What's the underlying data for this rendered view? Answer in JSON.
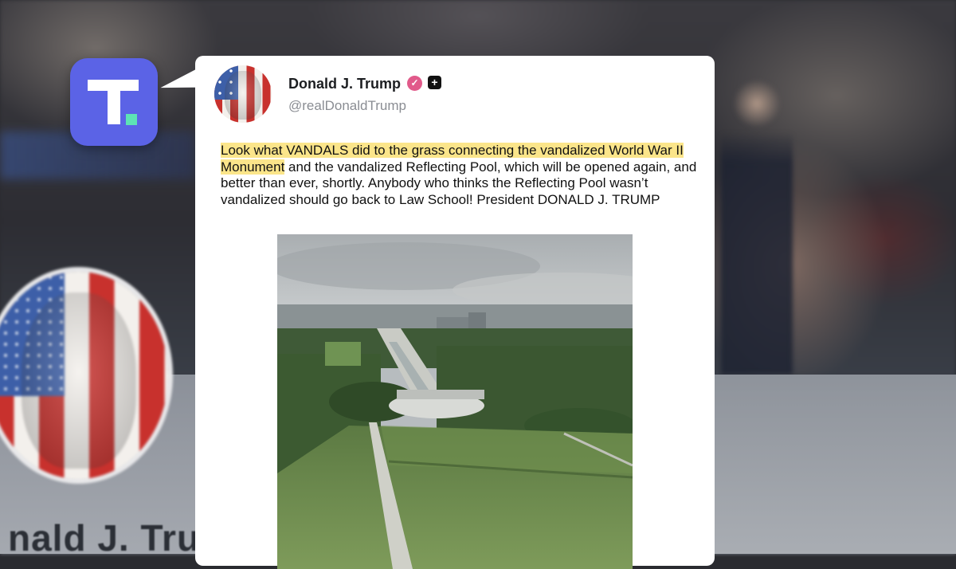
{
  "app": {
    "logo_icon": "truth-social-logo-icon",
    "brand_color": "#5b63e6",
    "accent_color": "#5de3b5"
  },
  "background": {
    "name_text": "nald J. Trum"
  },
  "post": {
    "display_name": "Donald J. Trump",
    "handle": "@realDonaldTrump",
    "verified_icon": "verified-badge-icon",
    "plus_icon": "plus-badge-icon",
    "text_highlighted": "Look what VANDALS did to the grass connecting the vandalized World War II Monument",
    "text_rest": " and the vandalized Reflecting Pool, which will be opened again, and better than ever, shortly. Anybody who thinks the Reflecting Pool wasn’t vandalized should go back to Law School! President DONALD J. TRUMP",
    "highlight_color": "#fbe58a",
    "image_icon": "aerial-photo-national-mall"
  }
}
